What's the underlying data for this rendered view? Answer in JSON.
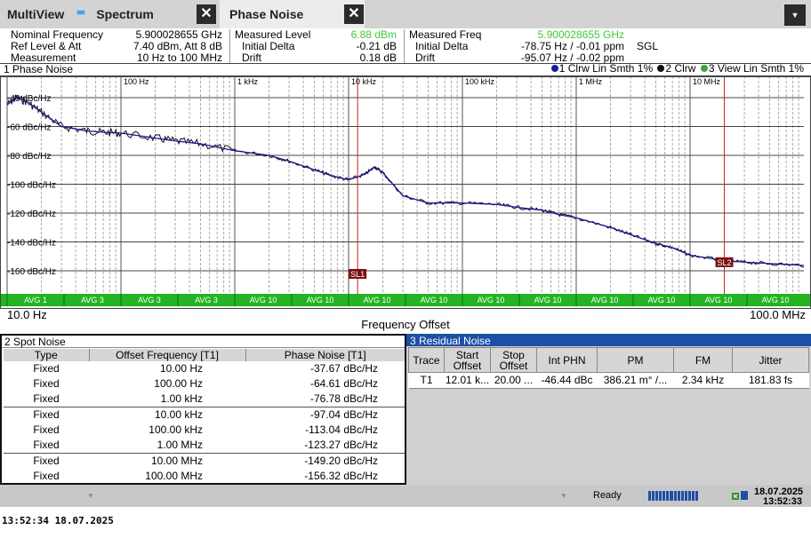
{
  "tabs": {
    "multiview": "MultiView",
    "spectrum": "Spectrum",
    "phase_noise": "Phase Noise",
    "close_symbol": "✕",
    "dropdown_symbol": "▼"
  },
  "info": {
    "nominal_freq_label": "Nominal Frequency",
    "nominal_freq_value": "5.900028655 GHz",
    "ref_level_label": "Ref Level & Att",
    "ref_level_value": "7.40 dBm, Att 8 dB",
    "measurement_label": "Measurement",
    "measurement_value": "10 Hz to 100 MHz",
    "measured_level_label": "Measured Level",
    "measured_level_value": "6.88 dBm",
    "level_initial_delta_label": "Initial Delta",
    "level_initial_delta_value": "-0.21 dB",
    "level_drift_label": "Drift",
    "level_drift_value": "0.18 dB",
    "measured_freq_label": "Measured Freq",
    "measured_freq_value": "5.900028655 GHz",
    "freq_initial_delta_label": "Initial Delta",
    "freq_initial_delta_value": "-78.75 Hz / -0.01 ppm",
    "freq_drift_label": "Drift",
    "freq_drift_value": "-95.07 Hz / -0.02 ppm",
    "sweep_mode": "SGL",
    "highlight_color": "#3ec93e"
  },
  "window1": {
    "title": "1 Phase Noise",
    "legend": [
      {
        "label": "1 Clrw Lin Smth 1%",
        "color": "#1a1aa0"
      },
      {
        "label": "2 Clrw",
        "color": "#111111"
      },
      {
        "label": "3 View Lin Smth 1%",
        "color": "#3aa83a"
      }
    ],
    "start_freq": "10.0 Hz",
    "stop_freq": "100.0 MHz",
    "x_axis_label": "Frequency Offset",
    "decade_labels": [
      "100 Hz",
      "1 kHz",
      "10 kHz",
      "100 kHz",
      "1 MHz",
      "10 MHz"
    ],
    "y_labels": [
      "-40 dBc/Hz",
      "-60 dBc/Hz",
      "-80 dBc/Hz",
      "-100 dBc/Hz",
      "-120 dBc/Hz",
      "-140 dBc/Hz",
      "-160 dBc/Hz"
    ],
    "avg_labels": [
      "AVG 1",
      "AVG 3",
      "AVG 3",
      "AVG 3",
      "AVG 10",
      "AVG 10",
      "AVG 10",
      "AVG 10",
      "AVG 10",
      "AVG 10",
      "AVG 10",
      "AVG 10",
      "AVG 10",
      "AVG 10"
    ],
    "markers": [
      "SL1",
      "SL2"
    ],
    "avg_color": "#22b422",
    "marker_line_color": "#d02020"
  },
  "chart_data": {
    "type": "line",
    "x_scale": "log",
    "xlim": [
      10,
      100000000
    ],
    "ylim": [
      -170,
      -30
    ],
    "y_ticks": [
      -40,
      -60,
      -80,
      -100,
      -120,
      -140,
      -160
    ],
    "grid": true,
    "legend_position": "top-right",
    "series": [
      {
        "name": "1 Clrw Lin Smth 1%",
        "x": [
          10,
          12,
          15,
          20,
          30,
          50,
          70,
          100,
          200,
          300,
          500,
          1000,
          2000,
          3000,
          5000,
          7000,
          10000,
          14000,
          17000,
          20000,
          30000,
          50000,
          100000,
          200000,
          300000,
          500000,
          700000,
          1000000,
          2000000,
          3000000,
          5000000,
          7000000,
          10000000,
          20000000,
          30000000,
          50000000,
          100000000
        ],
        "values": [
          -45,
          -40,
          -43,
          -50,
          -60,
          -63,
          -64,
          -64.6,
          -68,
          -70,
          -72,
          -76.8,
          -80,
          -84,
          -90,
          -94,
          -97,
          -93,
          -88,
          -92,
          -108,
          -113,
          -113,
          -114,
          -116,
          -118,
          -121,
          -123.3,
          -130,
          -135,
          -141,
          -144,
          -149.2,
          -153,
          -154,
          -155,
          -156.3
        ]
      }
    ],
    "spot_points": [
      [
        10,
        -37.67
      ],
      [
        100,
        -64.61
      ],
      [
        1000,
        -76.78
      ],
      [
        10000,
        -97.04
      ],
      [
        100000,
        -113.04
      ],
      [
        1000000,
        -123.27
      ],
      [
        10000000,
        -149.2
      ],
      [
        100000000,
        -156.32
      ]
    ],
    "markers": [
      {
        "label": "SL1",
        "x": 12000
      },
      {
        "label": "SL2",
        "x": 20000000
      }
    ]
  },
  "spot": {
    "title": "2 Spot Noise",
    "headers": [
      "Type",
      "Offset Frequency [T1]",
      "Phase Noise [T1]"
    ],
    "rows": [
      [
        "Fixed",
        "10.00 Hz",
        "-37.67 dBc/Hz"
      ],
      [
        "Fixed",
        "100.00 Hz",
        "-64.61 dBc/Hz"
      ],
      [
        "Fixed",
        "1.00 kHz",
        "-76.78 dBc/Hz"
      ],
      [
        "Fixed",
        "10.00 kHz",
        "-97.04 dBc/Hz"
      ],
      [
        "Fixed",
        "100.00 kHz",
        "-113.04 dBc/Hz"
      ],
      [
        "Fixed",
        "1.00 MHz",
        "-123.27 dBc/Hz"
      ],
      [
        "Fixed",
        "10.00 MHz",
        "-149.20 dBc/Hz"
      ],
      [
        "Fixed",
        "100.00 MHz",
        "-156.32 dBc/Hz"
      ]
    ]
  },
  "residual": {
    "title": "3 Residual Noise",
    "headers": [
      "Trace",
      "Start Offset",
      "Stop Offset",
      "Int PHN",
      "PM",
      "FM",
      "Jitter"
    ],
    "row": [
      "T1",
      "12.01 k...",
      "20.00 ...",
      "-46.44 dBc",
      "386.21 m° /...",
      "2.34 kHz",
      "181.83 fs"
    ]
  },
  "status": {
    "ready": "Ready",
    "date": "18.07.2025",
    "time": "13:52:33"
  },
  "footer": "13:52:34  18.07.2025"
}
